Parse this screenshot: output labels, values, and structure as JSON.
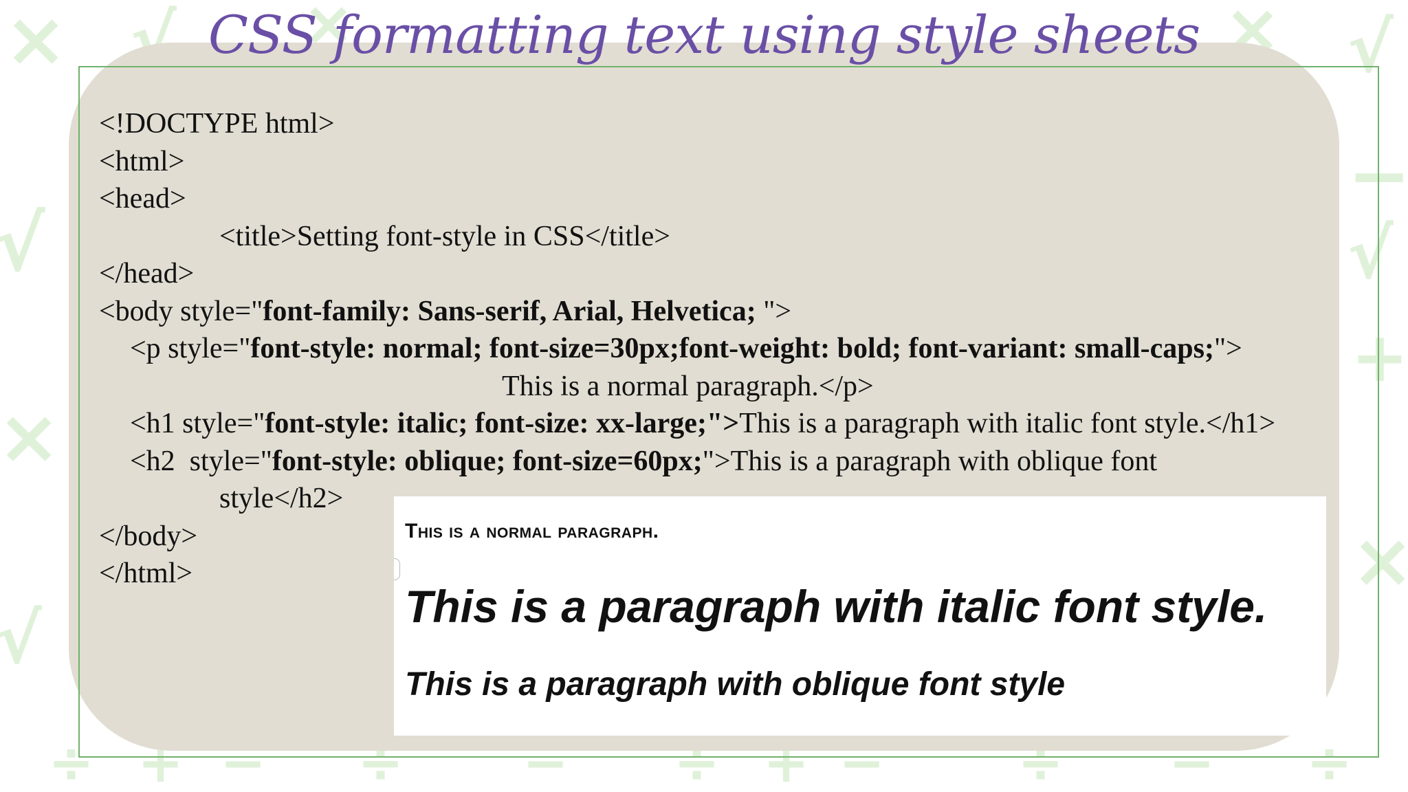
{
  "slide": {
    "title": "CSS formatting text using style sheets"
  },
  "code": {
    "doctype": "<!DOCTYPE html>",
    "html_open": "<html>",
    "head_open": "<head>",
    "title_line": "<title>Setting font-style in CSS</title>",
    "head_close": "</head>",
    "body_prefix": "<body style=\"",
    "body_bold": "font-family: Sans-serif, Arial, Helvetica; ",
    "body_suffix": "\">",
    "p_prefix": "<p style=\"",
    "p_bold": "font-style: normal; font-size=30px;font-weight: bold; font-variant: small-caps;",
    "p_suffix": "\">",
    "p_content": "This is a normal paragraph.</p>",
    "h1_prefix": "<h1 style=\"",
    "h1_bold": "font-style: italic; font-size: xx-large;\">",
    "h1_suffix": "This is a paragraph with italic font style.</h1>",
    "h2_prefix": "<h2  style=\"",
    "h2_bold": "font-style: oblique; font-size=60px;",
    "h2_suffix": "\">This is a paragraph with oblique font",
    "h2_cont": "style</h2>",
    "body_close": "</body>",
    "html_close": "</html>"
  },
  "output": {
    "normal_paragraph": "This is a normal paragraph.",
    "italic_heading": "This is a paragraph with italic font style.",
    "oblique_heading": "This is a paragraph with oblique font style"
  },
  "colors": {
    "title": "#6a4fa6",
    "panel": "#e1ddd2",
    "frame": "#70b26a",
    "background_symbols": "#c7e6bd"
  }
}
